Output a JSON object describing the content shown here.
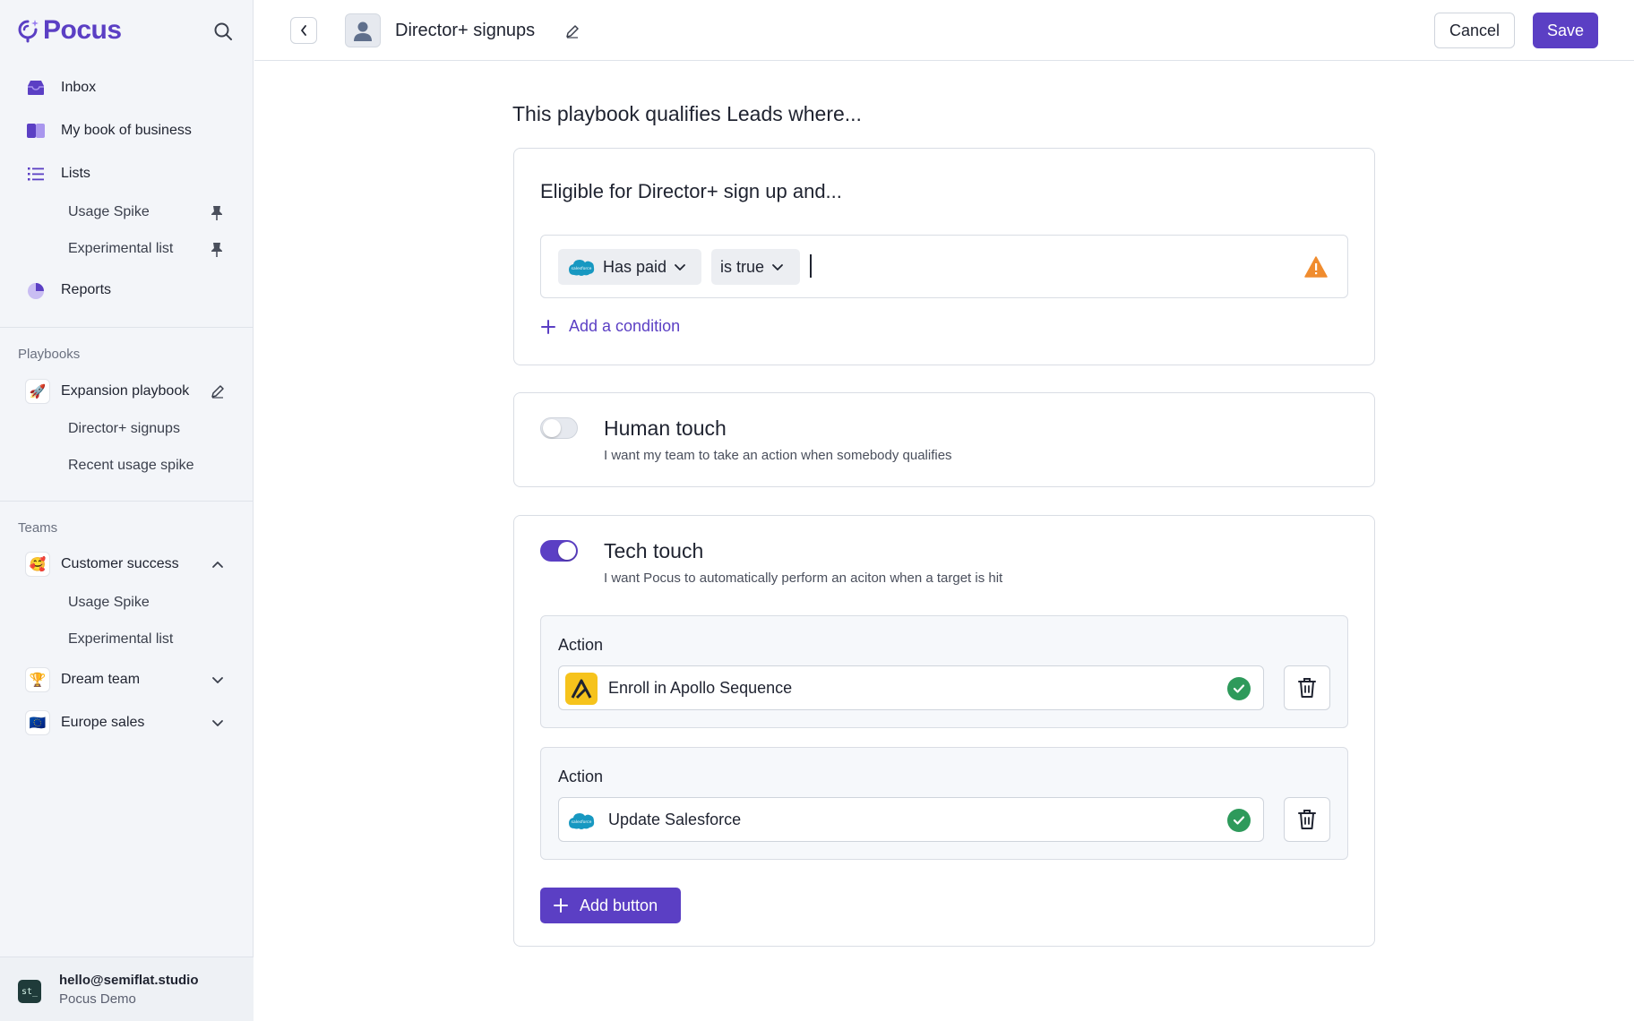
{
  "app": {
    "name": "Pocus"
  },
  "sidebar": {
    "nav": [
      {
        "label": "Inbox",
        "icon": "inbox-icon"
      },
      {
        "label": "My book of business",
        "icon": "book-icon"
      },
      {
        "label": "Lists",
        "icon": "list-icon"
      },
      {
        "label": "Reports",
        "icon": "pie-chart-icon"
      }
    ],
    "lists": [
      {
        "label": "Usage Spike",
        "pinned": true
      },
      {
        "label": "Experimental list",
        "pinned": true
      }
    ],
    "playbooks_label": "Playbooks",
    "playbook": {
      "label": "Expansion playbook",
      "emoji": "🚀"
    },
    "playbook_items": [
      "Director+ signups",
      "Recent usage spike"
    ],
    "teams_label": "Teams",
    "teams": [
      {
        "label": "Customer success",
        "emoji": "🥰",
        "expanded": true
      },
      {
        "label": "Dream team",
        "emoji": "🏆",
        "expanded": false
      },
      {
        "label": "Europe sales",
        "emoji": "🇪🇺",
        "expanded": false
      }
    ],
    "team_items": [
      "Usage Spike",
      "Experimental list"
    ],
    "user": {
      "email": "hello@semiflat.studio",
      "org": "Pocus Demo",
      "initials": "st_"
    }
  },
  "header": {
    "title": "Director+ signups",
    "cancel_label": "Cancel",
    "save_label": "Save"
  },
  "main": {
    "intro": "This playbook qualifies Leads where...",
    "qualify": {
      "title": "Eligible for Director+ sign up and...",
      "condition": {
        "field": "Has paid",
        "operator": "is true",
        "source": "salesforce"
      },
      "add_condition_label": "Add a condition"
    },
    "human_touch": {
      "title": "Human touch",
      "description": "I want my team to take an action when somebody qualifies",
      "enabled": false
    },
    "tech_touch": {
      "title": "Tech touch",
      "description": "I want Pocus to automatically perform an aciton when a target is hit",
      "enabled": true,
      "actions": [
        {
          "label": "Action",
          "value": "Enroll in Apollo Sequence",
          "icon": "apollo-icon",
          "status": "valid"
        },
        {
          "label": "Action",
          "value": "Update Salesforce",
          "icon": "salesforce-icon",
          "status": "valid"
        }
      ],
      "add_button_label": "Add button"
    }
  },
  "colors": {
    "accent": "#5b3fc4",
    "success": "#2e9a5b",
    "warning": "#f08c2e",
    "salesforce": "#1798c1"
  }
}
